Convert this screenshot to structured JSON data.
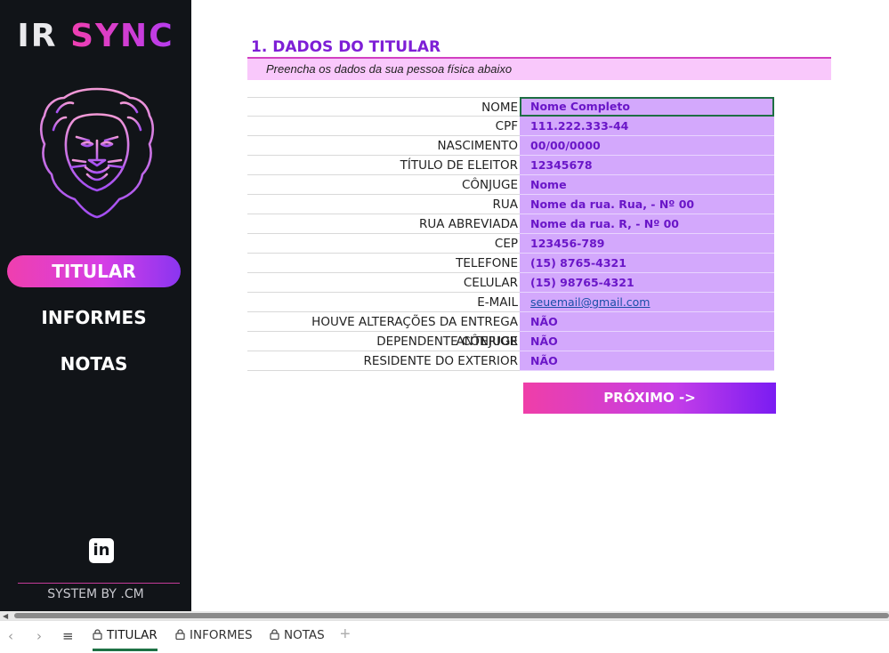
{
  "sidebar": {
    "logo_part1": "IR",
    "logo_part2": "SYNC",
    "nav": [
      {
        "label": "TITULAR",
        "active": true
      },
      {
        "label": "INFORMES",
        "active": false
      },
      {
        "label": "NOTAS",
        "active": false
      }
    ],
    "linkedin_icon": "in",
    "footer": "SYSTEM BY .CM"
  },
  "main": {
    "title": "1. DADOS DO TITULAR",
    "subtitle": "Preencha os dados da sua pessoa física abaixo",
    "fields": [
      {
        "label": "NOME",
        "value": "Nome Completo"
      },
      {
        "label": "CPF",
        "value": "111.222.333-44"
      },
      {
        "label": "NASCIMENTO",
        "value": "00/00/0000"
      },
      {
        "label": "TÍTULO DE ELEITOR",
        "value": "12345678"
      },
      {
        "label": "CÔNJUGE",
        "value": "Nome"
      },
      {
        "label": "RUA",
        "value": "Nome da rua. Rua, - Nº 00"
      },
      {
        "label": "RUA ABREVIADA",
        "value": "Nome da rua. R, - Nº 00"
      },
      {
        "label": "CEP",
        "value": "123456-789"
      },
      {
        "label": "TELEFONE",
        "value": "(15) 8765-4321"
      },
      {
        "label": "CELULAR",
        "value": "(15) 98765-4321"
      },
      {
        "label": "E-MAIL",
        "value": "seuemail@gmail.com"
      },
      {
        "label": "HOUVE ALTERAÇÕES DA ENTREGA ANTERIOR",
        "value": "NÃO"
      },
      {
        "label": "DEPENDENTE CÔNJUGE",
        "value": "NÃO"
      },
      {
        "label": "RESIDENTE DO EXTERIOR",
        "value": "NÃO"
      }
    ],
    "next_button": "PRÓXIMO ->"
  },
  "tabbar": {
    "prev": "‹",
    "next": "›",
    "menu": "≡",
    "add": "+",
    "tabs": [
      {
        "label": "TITULAR",
        "active": true
      },
      {
        "label": "INFORMES",
        "active": false
      },
      {
        "label": "NOTAS",
        "active": false
      }
    ]
  },
  "colors": {
    "sidebar_bg": "#111418",
    "accent_pink": "#ef3fae",
    "accent_purple": "#7e1fd6",
    "field_bg": "#d3a8fc",
    "active_tab": "#1e7145"
  },
  "icons": [
    "lion-logo-icon",
    "linkedin-icon",
    "lock-icon",
    "chevron-left-icon",
    "chevron-right-icon",
    "menu-icon",
    "plus-icon"
  ]
}
